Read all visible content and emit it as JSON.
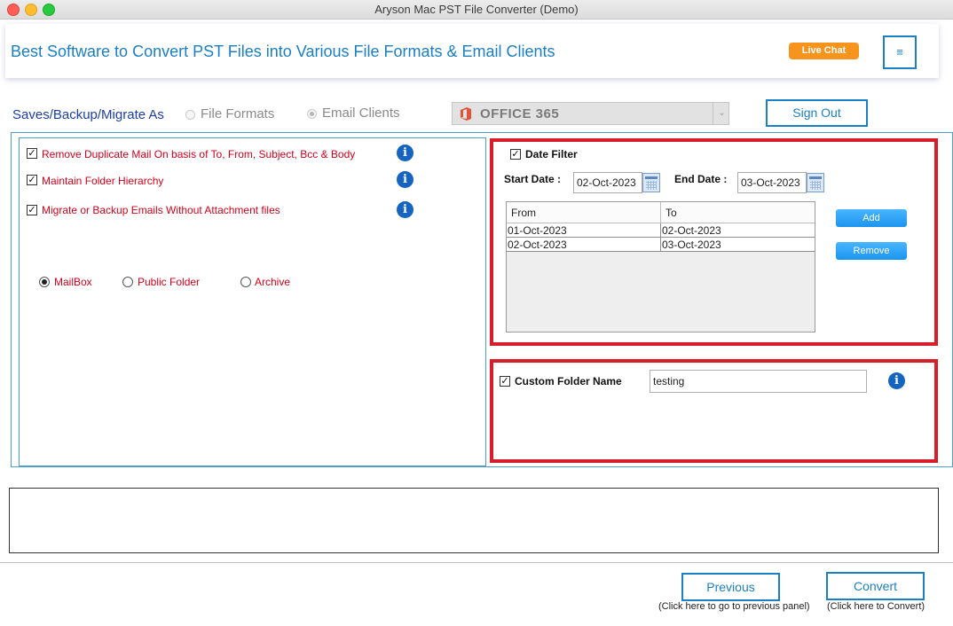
{
  "window": {
    "title": "Aryson Mac PST File Converter (Demo)"
  },
  "banner": {
    "title": "Best Software to Convert PST Files into Various File Formats & Email Clients",
    "live_chat": "Live Chat",
    "menu_icon": "≡"
  },
  "save_row": {
    "label": "Saves/Backup/Migrate As",
    "file_formats": "File Formats",
    "email_clients": "Email Clients",
    "selected": "Email Clients",
    "destination": "OFFICE 365",
    "sign_out": "Sign Out"
  },
  "options": {
    "remove_duplicate": "Remove Duplicate Mail On basis of To, From, Subject, Bcc & Body",
    "maintain_hierarchy": "Maintain Folder Hierarchy",
    "without_attachment": "Migrate or Backup Emails Without Attachment files",
    "checked": [
      true,
      true,
      true
    ],
    "mailbox": "MailBox",
    "public_folder": "Public Folder",
    "archive": "Archive",
    "selected_type": "MailBox"
  },
  "date_filter": {
    "label": "Date Filter",
    "enabled": true,
    "start_label": "Start Date :",
    "start_value": "02-Oct-2023",
    "end_label": "End Date :",
    "end_value": "03-Oct-2023",
    "columns": [
      "From",
      "To"
    ],
    "rows": [
      [
        "01-Oct-2023",
        "02-Oct-2023"
      ],
      [
        "02-Oct-2023",
        "03-Oct-2023"
      ]
    ],
    "add": "Add",
    "remove": "Remove"
  },
  "custom_folder": {
    "label": "Custom Folder Name",
    "enabled": true,
    "value": "testing"
  },
  "footer": {
    "previous": "Previous",
    "previous_hint": "(Click here to go to previous panel)",
    "convert": "Convert",
    "convert_hint": "(Click here to Convert)"
  },
  "colors": {
    "accent": "#1a7fc4",
    "highlight_border": "#d81e2a",
    "option_text": "#d0021b",
    "live_chat": "#f7941d"
  }
}
